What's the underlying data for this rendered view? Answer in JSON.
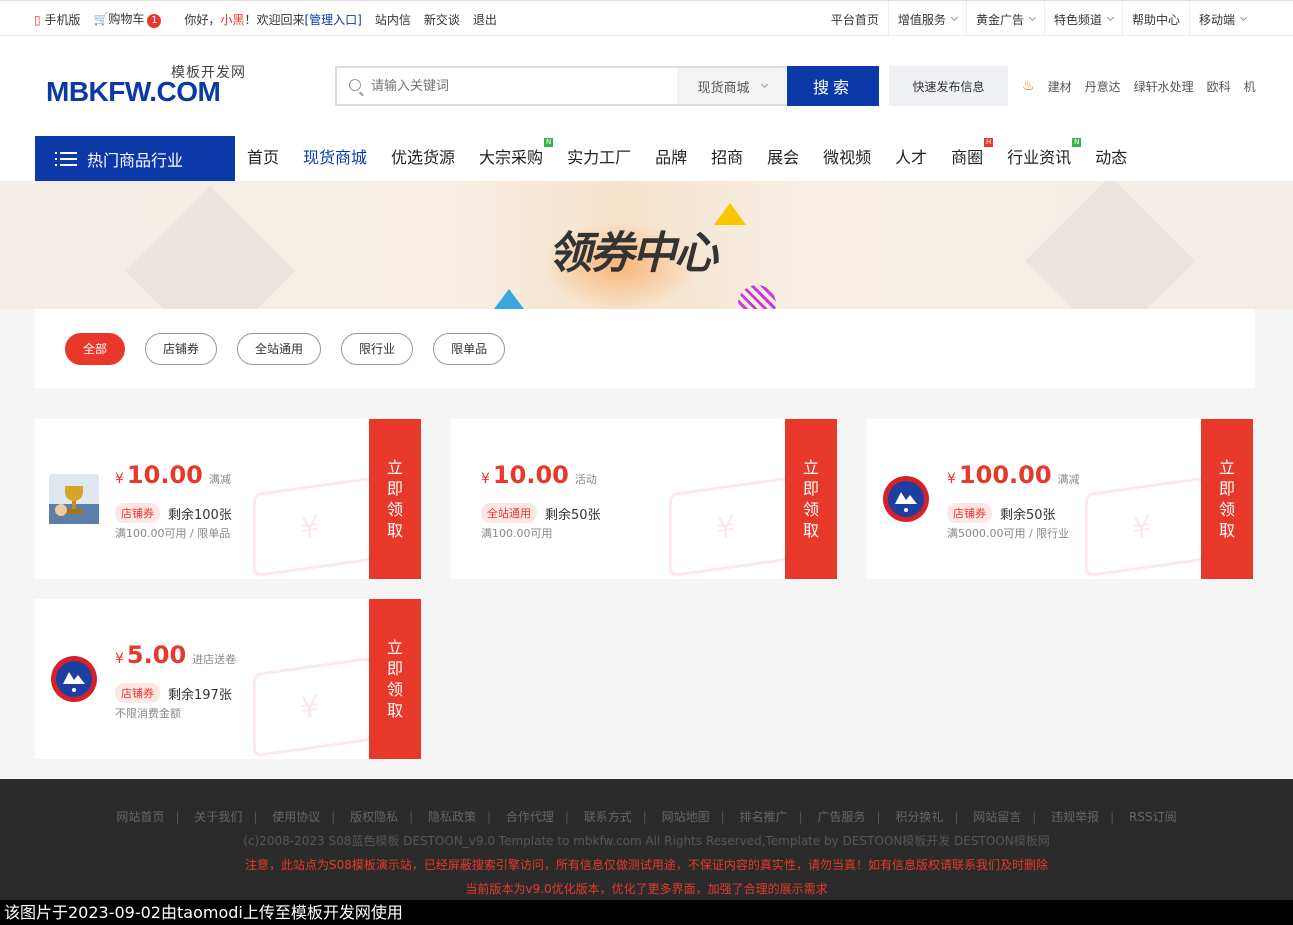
{
  "topbar": {
    "mobile": "手机版",
    "cart": "购物车",
    "cart_count": "1",
    "greeting": "你好，",
    "username": "小黑",
    "welcome": "！欢迎回来",
    "admin": "[管理入口]",
    "inbox": "站内信",
    "trade": "新交谈",
    "logout": "退出",
    "right": [
      "平台首页",
      "增值服务",
      "黄金广告",
      "特色频道",
      "帮助中心",
      "移动端"
    ]
  },
  "header": {
    "logo_sub": "模板开发网",
    "logo_main": "MBKFW.COM",
    "search_placeholder": "请输入关键词",
    "search_scope": "现货商城",
    "search_button": "搜索",
    "publish_button": "快速发布信息",
    "hot_words": [
      "建材",
      "丹意达",
      "绿轩水处理",
      "欧科",
      "机"
    ]
  },
  "nav": {
    "category": "热门商品行业",
    "items": [
      "首页",
      "现货商城",
      "优选货源",
      "大宗采购",
      "实力工厂",
      "品牌",
      "招商",
      "展会",
      "微视频",
      "人才",
      "商圈",
      "行业资讯",
      "动态"
    ],
    "active": "现货商城"
  },
  "banner": {
    "title": "领券中心"
  },
  "filters": [
    "全部",
    "店铺券",
    "全站通用",
    "限行业",
    "限单品"
  ],
  "coupons": [
    {
      "currency": "¥",
      "value": "10.00",
      "type": "满减",
      "tag": "店铺券",
      "remaining": "剩余100张",
      "condition": "满100.00可用 / 限单品",
      "action": "立即领取"
    },
    {
      "currency": "¥",
      "value": "10.00",
      "type": "活动",
      "tag": "全站通用",
      "remaining": "剩余50张",
      "condition": "满100.00可用",
      "action": "立即领取"
    },
    {
      "currency": "¥",
      "value": "100.00",
      "type": "满减",
      "tag": "店铺券",
      "remaining": "剩余50张",
      "condition": "满5000.00可用 / 限行业",
      "action": "立即领取"
    },
    {
      "currency": "¥",
      "value": "5.00",
      "type": "进店送卷",
      "tag": "店铺券",
      "remaining": "剩余197张",
      "condition": "不限消费金额",
      "action": "立即领取"
    }
  ],
  "footer": {
    "links": [
      "网站首页",
      "关于我们",
      "使用协议",
      "版权隐私",
      "隐私政策",
      "合作代理",
      "联系方式",
      "网站地图",
      "排名推广",
      "广告服务",
      "积分换礼",
      "网站留言",
      "违规举报",
      "RSS订阅"
    ],
    "copyright": "(c)2008-2023 S08蓝色模板 DESTOON_v9.0 Template to mbkfw.com All Rights Reserved,Template by DESTOON模板开发 DESTOON模板网",
    "warning1": "注意，此站点为S08模板演示站，已经屏蔽搜索引擎访问，所有信息仅做测试用途，不保证内容的真实性，请勿当真！如有信息版权请联系我们及时删除",
    "warning2": "当前版本为v9.0优化版本，优化了更多界面，加强了合理的展示需求"
  },
  "watermark": "该图片于2023-09-02由taomodi上传至模板开发网使用",
  "colors": {
    "brand": "#0b3aa8",
    "accent": "#e8382b"
  }
}
